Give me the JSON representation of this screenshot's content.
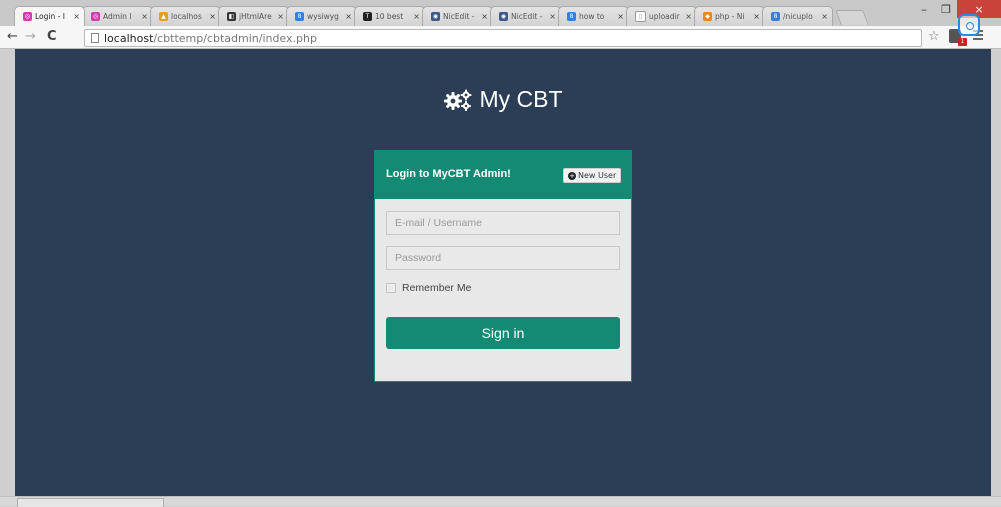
{
  "browser": {
    "tabs": [
      {
        "title": "Login - I",
        "favicon_color": "#d43bb0",
        "favicon_glyph": "◎",
        "active": true
      },
      {
        "title": "Admin I",
        "favicon_color": "#d43bb0",
        "favicon_glyph": "◎",
        "active": false
      },
      {
        "title": "localhos",
        "favicon_color": "#e0a020",
        "favicon_glyph": "▲",
        "active": false
      },
      {
        "title": "jHtmlAre",
        "favicon_color": "#333333",
        "favicon_glyph": "◧",
        "active": false
      },
      {
        "title": "wysiwyg",
        "favicon_color": "#3a7ddb",
        "favicon_glyph": "8",
        "active": false
      },
      {
        "title": "10 best",
        "favicon_color": "#222222",
        "favicon_glyph": "T",
        "active": false
      },
      {
        "title": "NicEdit -",
        "favicon_color": "#3a5a8a",
        "favicon_glyph": "◉",
        "active": false
      },
      {
        "title": "NicEdit -",
        "favicon_color": "#3a5a8a",
        "favicon_glyph": "◉",
        "active": false
      },
      {
        "title": "how to",
        "favicon_color": "#3a7ddb",
        "favicon_glyph": "8",
        "active": false
      },
      {
        "title": "uploadir",
        "favicon_color": "#ffffff",
        "favicon_glyph": "▯",
        "active": false
      },
      {
        "title": "php - Ni",
        "favicon_color": "#e08a20",
        "favicon_glyph": "◆",
        "active": false
      },
      {
        "title": "/nicuplo",
        "favicon_color": "#3a7ddb",
        "favicon_glyph": "8",
        "active": false
      }
    ],
    "tab_close_glyph": "×",
    "window_controls": {
      "minimize": "–",
      "restore": "❐",
      "close": "×"
    },
    "nav": {
      "back": "←",
      "forward": "→",
      "reload": "C"
    },
    "url": {
      "host": "localhost",
      "path": "/cbttemp/cbtadmin/index.php"
    },
    "bookmark_star": "☆",
    "extension_badge": "1"
  },
  "app": {
    "brand_icon": "gears-icon",
    "brand_title": "My CBT",
    "login": {
      "title": "Login to MyCBT Admin!",
      "new_user_icon": "plus-circle-icon",
      "new_user_label": "New User",
      "email_placeholder": "E-mail / Username",
      "password_placeholder": "Password",
      "remember_label": "Remember Me",
      "remember_checked": false,
      "signin_label": "Sign in"
    }
  },
  "colors": {
    "page_background": "#2c3e56",
    "accent": "#148a74",
    "panel_background": "#e8e8e8"
  }
}
